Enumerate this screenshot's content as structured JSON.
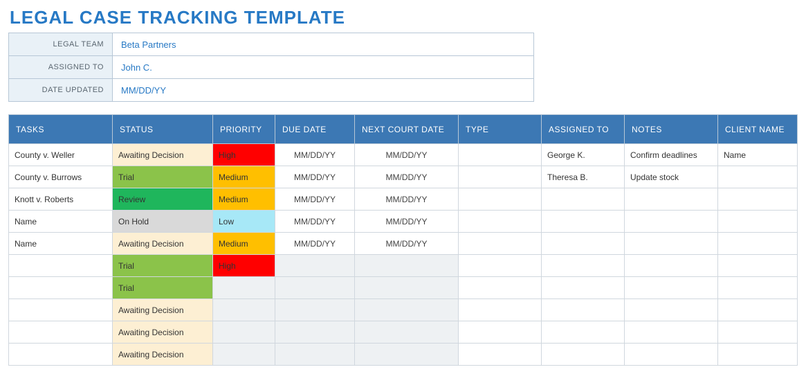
{
  "title": "LEGAL CASE TRACKING TEMPLATE",
  "meta": {
    "labels": {
      "legal_team": "LEGAL TEAM",
      "assigned_to": "ASSIGNED TO",
      "date_updated": "DATE UPDATED"
    },
    "legal_team": "Beta Partners",
    "assigned_to": "John C.",
    "date_updated": "MM/DD/YY"
  },
  "headers": {
    "tasks": "TASKS",
    "status": "STATUS",
    "priority": "PRIORITY",
    "due": "DUE DATE",
    "court": "NEXT COURT DATE",
    "type": "TYPE",
    "assigned": "ASSIGNED TO",
    "notes": "NOTES",
    "client": "CLIENT NAME"
  },
  "rows": [
    {
      "task": "County v. Weller",
      "status": "Awaiting Decision",
      "status_class": "status-awaiting",
      "priority": "High",
      "priority_class": "pri-high",
      "due": "MM/DD/YY",
      "court": "MM/DD/YY",
      "type": "",
      "assigned": "George K.",
      "notes": "Confirm deadlines",
      "client": "Name"
    },
    {
      "task": "County v. Burrows",
      "status": "Trial",
      "status_class": "status-trial",
      "priority": "Medium",
      "priority_class": "pri-medium",
      "due": "MM/DD/YY",
      "court": "MM/DD/YY",
      "type": "",
      "assigned": "Theresa B.",
      "notes": "Update stock",
      "client": ""
    },
    {
      "task": "Knott v. Roberts",
      "status": "Review",
      "status_class": "status-review",
      "priority": "Medium",
      "priority_class": "pri-medium",
      "due": "MM/DD/YY",
      "court": "MM/DD/YY",
      "type": "",
      "assigned": "",
      "notes": "",
      "client": ""
    },
    {
      "task": "Name",
      "status": "On Hold",
      "status_class": "status-hold",
      "priority": "Low",
      "priority_class": "pri-low",
      "due": "MM/DD/YY",
      "court": "MM/DD/YY",
      "type": "",
      "assigned": "",
      "notes": "",
      "client": ""
    },
    {
      "task": "Name",
      "status": "Awaiting Decision",
      "status_class": "status-awaiting",
      "priority": "Medium",
      "priority_class": "pri-medium",
      "due": "MM/DD/YY",
      "court": "MM/DD/YY",
      "type": "",
      "assigned": "",
      "notes": "",
      "client": ""
    },
    {
      "task": "",
      "status": "Trial",
      "status_class": "status-trial",
      "priority": "High",
      "priority_class": "pri-high",
      "due": "",
      "court": "",
      "type": "",
      "assigned": "",
      "notes": "",
      "client": ""
    },
    {
      "task": "",
      "status": "Trial",
      "status_class": "status-trial",
      "priority": "",
      "priority_class": "",
      "due": "",
      "court": "",
      "type": "",
      "assigned": "",
      "notes": "",
      "client": ""
    },
    {
      "task": "",
      "status": "Awaiting Decision",
      "status_class": "status-awaiting",
      "priority": "",
      "priority_class": "",
      "due": "",
      "court": "",
      "type": "",
      "assigned": "",
      "notes": "",
      "client": ""
    },
    {
      "task": "",
      "status": "Awaiting Decision",
      "status_class": "status-awaiting",
      "priority": "",
      "priority_class": "",
      "due": "",
      "court": "",
      "type": "",
      "assigned": "",
      "notes": "",
      "client": ""
    },
    {
      "task": "",
      "status": "Awaiting Decision",
      "status_class": "status-awaiting",
      "priority": "",
      "priority_class": "",
      "due": "",
      "court": "",
      "type": "",
      "assigned": "",
      "notes": "",
      "client": ""
    }
  ]
}
